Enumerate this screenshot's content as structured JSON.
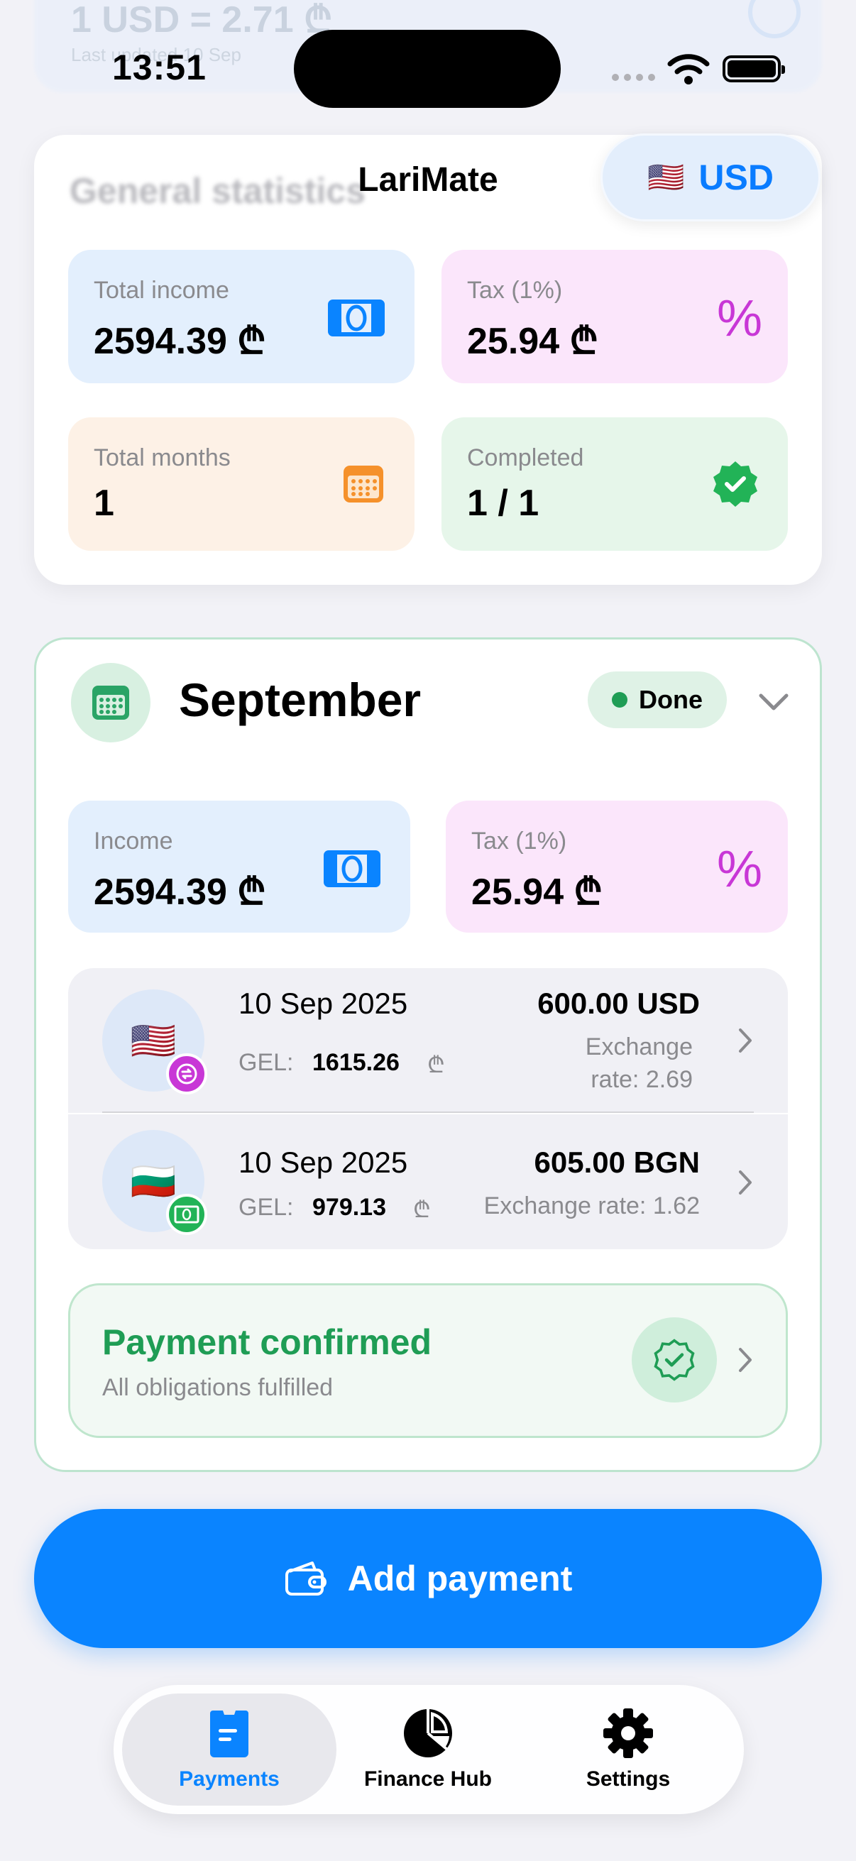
{
  "ghost": {
    "rate_text": "1 USD = 2.71 ₾",
    "sub_text": "Last updated 10 Sep"
  },
  "status_bar": {
    "time": "13:51"
  },
  "nav": {
    "title": "LariMate",
    "currency_flag": "🇺🇸",
    "currency_code": "USD",
    "blurred_heading": "General statistics"
  },
  "stats": {
    "total_income_label": "Total income",
    "total_income_value": "2594.39 ₾",
    "tax_label": "Tax (1%)",
    "tax_value": "25.94 ₾",
    "total_months_label": "Total months",
    "total_months_value": "1",
    "completed_label": "Completed",
    "completed_value": "1 / 1"
  },
  "month": {
    "title": "September",
    "status": "Done",
    "income_label": "Income",
    "income_value": "2594.39 ₾",
    "tax_label": "Tax (1%)",
    "tax_value": "25.94 ₾",
    "transactions": [
      {
        "flag": "🇺🇸",
        "date": "10 Sep 2025",
        "gel_label": "GEL:",
        "gel_value": "1615.26",
        "gel_symbol": "₾",
        "amount": "600.00 USD",
        "rate_line1": "Exchange",
        "rate_line2": "rate: 2.69"
      },
      {
        "flag": "🇧🇬",
        "date": "10 Sep 2025",
        "gel_label": "GEL:",
        "gel_value": "979.13",
        "gel_symbol": "₾",
        "amount": "605.00 BGN",
        "rate_line1": "Exchange rate: 1.62"
      }
    ],
    "confirmed_title": "Payment confirmed",
    "confirmed_sub": "All obligations fulfilled"
  },
  "add_button": {
    "label": "Add payment"
  },
  "tabs": [
    {
      "label": "Payments",
      "active": true
    },
    {
      "label": "Finance Hub",
      "active": false
    },
    {
      "label": "Settings",
      "active": false
    }
  ],
  "colors": {
    "accent": "#0a84ff",
    "success": "#1f9d55",
    "tax": "#c837d6",
    "calendar": "#f5912b"
  }
}
